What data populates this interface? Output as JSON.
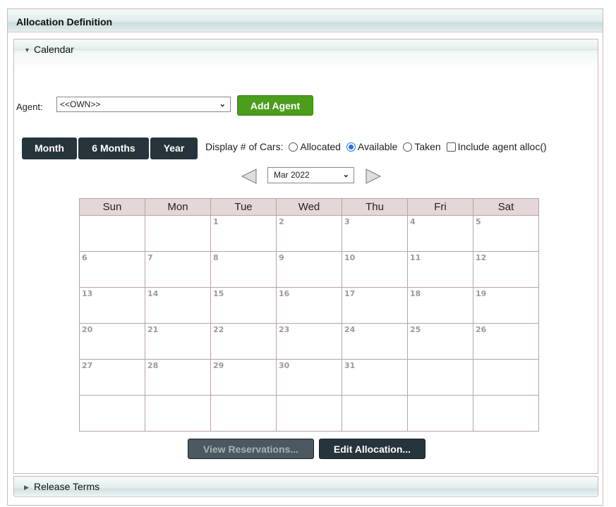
{
  "section": {
    "title": "Allocation Definition"
  },
  "calendar_panel": {
    "title": "Calendar",
    "expanded": true
  },
  "release_panel": {
    "title": "Release Terms",
    "expanded": false
  },
  "agent": {
    "label": "Agent:",
    "selected": "<<OWN>>",
    "add_button": "Add Agent"
  },
  "range_buttons": [
    "Month",
    "6 Months",
    "Year"
  ],
  "display": {
    "label": "Display # of Cars:",
    "options": [
      {
        "label": "Allocated",
        "checked": false
      },
      {
        "label": "Available",
        "checked": true
      },
      {
        "label": "Taken",
        "checked": false
      }
    ],
    "include_label": "Include agent alloc()",
    "include_checked": false
  },
  "month_selector": {
    "selected": "Mar 2022"
  },
  "weekdays": [
    "Sun",
    "Mon",
    "Tue",
    "Wed",
    "Thu",
    "Fri",
    "Sat"
  ],
  "weeks": [
    [
      "",
      "",
      "1",
      "2",
      "3",
      "4",
      "5"
    ],
    [
      "6",
      "7",
      "8",
      "9",
      "10",
      "11",
      "12"
    ],
    [
      "13",
      "14",
      "15",
      "16",
      "17",
      "18",
      "19"
    ],
    [
      "20",
      "21",
      "22",
      "23",
      "24",
      "25",
      "26"
    ],
    [
      "27",
      "28",
      "29",
      "30",
      "31",
      "",
      ""
    ],
    [
      "",
      "",
      "",
      "",
      "",
      "",
      ""
    ]
  ],
  "actions": {
    "view_reservations": "View Reservations...",
    "edit_allocation": "Edit Allocation..."
  },
  "colors": {
    "add_agent": "#4b9e1c",
    "dark_button": "#26343b",
    "header_cell": "#e5d7d7",
    "radio_selected": "#1a73e8"
  }
}
